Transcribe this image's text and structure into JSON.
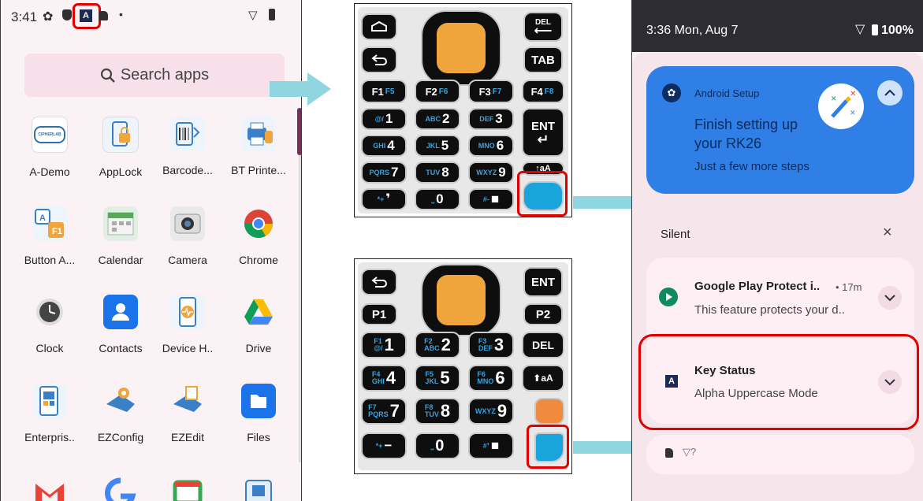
{
  "left_phone": {
    "status_time": "3:41",
    "search_placeholder": "Search apps",
    "apps": [
      {
        "label": "A-Demo",
        "icon": "ciphermab-icon"
      },
      {
        "label": "AppLock",
        "icon": "applock-icon"
      },
      {
        "label": "Barcode...",
        "icon": "barcode-icon"
      },
      {
        "label": "BT Printe...",
        "icon": "bt-printer-icon"
      },
      {
        "label": "Button A...",
        "icon": "button-assign-icon"
      },
      {
        "label": "Calendar",
        "icon": "calendar-icon"
      },
      {
        "label": "Camera",
        "icon": "camera-icon"
      },
      {
        "label": "Chrome",
        "icon": "chrome-icon"
      },
      {
        "label": "Clock",
        "icon": "clock-icon"
      },
      {
        "label": "Contacts",
        "icon": "contacts-icon"
      },
      {
        "label": "Device H..",
        "icon": "device-health-icon"
      },
      {
        "label": "Drive",
        "icon": "drive-icon"
      },
      {
        "label": "Enterpris..",
        "icon": "enterprise-icon"
      },
      {
        "label": "EZConfig",
        "icon": "ezconfig-icon"
      },
      {
        "label": "EZEdit",
        "icon": "ezedit-icon"
      },
      {
        "label": "Files",
        "icon": "files-icon"
      }
    ],
    "cipher_logo_text": "CIPHERLAB"
  },
  "keypad1": {
    "del_label": "DEL",
    "tab_label": "TAB",
    "ent_label": "ENT",
    "fkeys": [
      {
        "main": "F1",
        "alt": "F5"
      },
      {
        "main": "F2",
        "alt": "F6"
      },
      {
        "main": "F3",
        "alt": "F7"
      },
      {
        "main": "F4",
        "alt": "F8"
      }
    ],
    "numkeys": [
      {
        "sub": "@/",
        "main": "1"
      },
      {
        "sub": "ABC",
        "main": "2"
      },
      {
        "sub": "DEF",
        "main": "3"
      },
      {
        "sub": "GHI",
        "main": "4"
      },
      {
        "sub": "JKL",
        "main": "5"
      },
      {
        "sub": "MNO",
        "main": "6"
      },
      {
        "sub": "PQRS",
        "main": "7"
      },
      {
        "sub": "TUV",
        "main": "8"
      },
      {
        "sub": "WXYZ",
        "main": "9"
      }
    ],
    "bottom_keys": [
      {
        "sub": "*+",
        "main": "❜"
      },
      {
        "sub": "⎵",
        "main": "0"
      },
      {
        "sub": "#-",
        "main": "■"
      }
    ],
    "shift_label": "↑aA"
  },
  "keypad2": {
    "ent_label": "ENT",
    "p1_label": "P1",
    "p2_label": "P2",
    "del_label": "DEL",
    "shift_label": "⬆aA",
    "numkeys": [
      {
        "f": "F1",
        "sub": "@/",
        "main": "1"
      },
      {
        "f": "F2",
        "sub": "ABC",
        "main": "2"
      },
      {
        "f": "F3",
        "sub": "DEF",
        "main": "3"
      },
      {
        "f": "F4",
        "sub": "GHI",
        "main": "4"
      },
      {
        "f": "F5",
        "sub": "JKL",
        "main": "5"
      },
      {
        "f": "F6",
        "sub": "MNO",
        "main": "6"
      },
      {
        "f": "F7",
        "sub": "PQRS",
        "main": "7"
      },
      {
        "f": "F8",
        "sub": "TUV",
        "main": "8"
      },
      {
        "f": "",
        "sub": "WXYZ",
        "main": "9"
      }
    ],
    "bottom_keys": [
      {
        "sub": "*+",
        "main": "−"
      },
      {
        "sub": "⎵",
        "main": "0"
      },
      {
        "sub": "#❜",
        "main": "■"
      }
    ]
  },
  "right_phone": {
    "status_datetime": "3:36 Mon, Aug 7",
    "battery_text": "100%",
    "setup_card": {
      "app_name": "Android Setup",
      "title_line1": "Finish setting up",
      "title_line2": "your RK26",
      "subtitle": "Just a few more steps"
    },
    "silent_header": "Silent",
    "close_glyph": "×",
    "play_protect": {
      "title": "Google Play Protect i..",
      "time": "• 17m",
      "body": "This feature protects your d.."
    },
    "key_status": {
      "title": "Key Status",
      "body": "Alpha Uppercase Mode",
      "icon_letter": "A"
    }
  },
  "colors": {
    "highlight_red": "#e00000",
    "arrow_cyan": "#8fd6e0",
    "setup_blue": "#2f7fe6",
    "key_orange": "#f0a43c",
    "key_blue": "#1aa4dc"
  }
}
